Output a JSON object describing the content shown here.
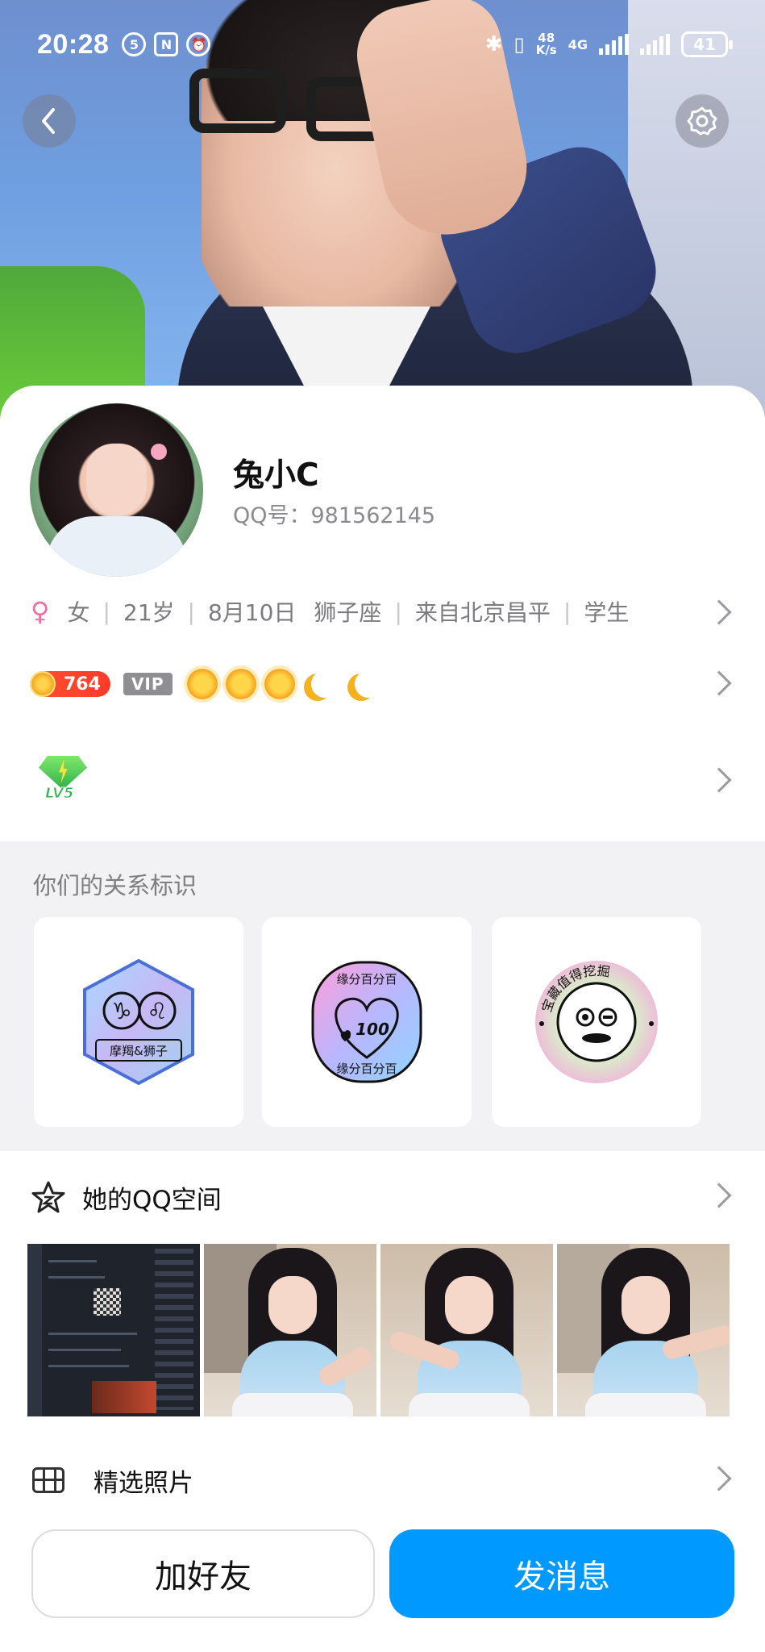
{
  "status_bar": {
    "time": "20:28",
    "net_speed_value": "48",
    "net_speed_unit": "K/s",
    "network": "4G",
    "battery": "41"
  },
  "profile": {
    "nickname": "兔小C",
    "qq_id": "QQ号：981562145",
    "info": {
      "gender_icon": "♀",
      "gender": "女",
      "age": "21岁",
      "birthday": "8月10日",
      "zodiac": "狮子座",
      "location": "来自北京昌平",
      "occupation": "学生"
    },
    "coin_level": "764",
    "vip_label": "VIP",
    "level_icons": [
      "sun",
      "sun",
      "sun",
      "moon",
      "moon"
    ],
    "diamond_level": "LV5"
  },
  "relationship": {
    "title": "你们的关系标识",
    "badges": [
      {
        "text": "摩羯&狮子",
        "symbols": [
          "♑",
          "♌"
        ]
      },
      {
        "text": "缘分百分百",
        "number": "100"
      },
      {
        "text": "宝藏值得挖掘"
      }
    ]
  },
  "qzone": {
    "label": "她的QQ空间"
  },
  "photos": {
    "label": "精选照片"
  },
  "actions": {
    "add_friend": "加好友",
    "send_message": "发消息"
  },
  "colors": {
    "accent": "#0099ff",
    "female": "#f06fa4"
  }
}
